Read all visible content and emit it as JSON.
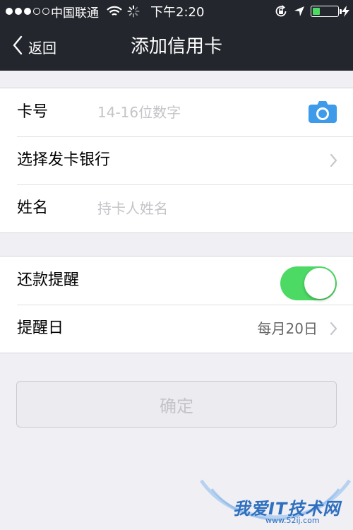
{
  "status_bar": {
    "carrier": "中国联通",
    "time": "下午2:20",
    "battery_level": 0.3
  },
  "nav": {
    "back_label": "返回",
    "title": "添加信用卡"
  },
  "form": {
    "card_number": {
      "label": "卡号",
      "placeholder": "14-16位数字",
      "value": ""
    },
    "bank": {
      "label": "选择发卡银行"
    },
    "name": {
      "label": "姓名",
      "placeholder": "持卡人姓名",
      "value": ""
    }
  },
  "reminder": {
    "label": "还款提醒",
    "enabled": true,
    "day_label": "提醒日",
    "day_value": "每月20日"
  },
  "confirm_label": "确定",
  "watermark": {
    "text": "我爱IT技术网",
    "sub": "www.52ij.com"
  },
  "colors": {
    "nav_background": "#23262d",
    "toggle_on": "#4cd964",
    "camera_icon": "#3d9be9",
    "page_background": "#efeff4"
  },
  "icons": {
    "back": "chevron-left-icon",
    "camera": "camera-icon",
    "disclosure": "chevron-right-icon"
  }
}
